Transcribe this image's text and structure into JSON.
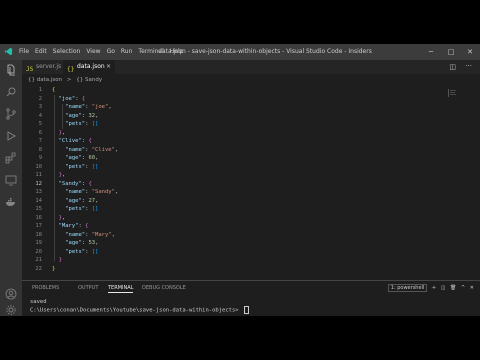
{
  "titlebar": {
    "menus": [
      "File",
      "Edit",
      "Selection",
      "View",
      "Go",
      "Run",
      "Terminal",
      "Help"
    ],
    "window_title": "data.json - save-json-data-within-objects - Visual Studio Code - Insiders"
  },
  "tabs": [
    {
      "icon": "JS",
      "label": "server.js",
      "active": false
    },
    {
      "icon": "{}",
      "label": "data.json",
      "active": true,
      "close": "×"
    }
  ],
  "breadcrumb": [
    "{} data.json",
    ">",
    "{} Sandy"
  ],
  "editor": {
    "line_numbers": [
      "1",
      "2",
      "3",
      "4",
      "5",
      "6",
      "7",
      "8",
      "9",
      "10",
      "11",
      "12",
      "13",
      "14",
      "15",
      "16",
      "17",
      "18",
      "19",
      "20",
      "21",
      "22"
    ],
    "current_line": 12
  },
  "code": {
    "joe_key": "\"joe\"",
    "name_key": "\"name\"",
    "age_key": "\"age\"",
    "pets_key": "\"pets\"",
    "joe_name": "\"joe\"",
    "joe_age": "32",
    "clive_key": "\"Clive\"",
    "clive_name": "\"Clive\"",
    "clive_age": "60",
    "sandy_key": "\"Sandy\"",
    "sandy_name": "\"Sandy\"",
    "sandy_age": "27",
    "mary_key": "\"Mary\"",
    "mary_name": "\"Mary\"",
    "mary_age": "53",
    "empty_array": "[]"
  },
  "panel": {
    "tabs": [
      "PROBLEMS",
      "OUTPUT",
      "TERMINAL",
      "DEBUG CONSOLE"
    ],
    "active_tab": "TERMINAL",
    "shell": "1: powershell",
    "terminal_lines": [
      "saved",
      "C:\\Users\\conan\\Documents\\Youtube\\save-json-data-within-objects> "
    ]
  },
  "colors": {
    "editor_bg": "#1e1e1e",
    "titlebar_bg": "#3c3c3c",
    "activity_bg": "#333333",
    "key": "#9cdcfe",
    "string": "#ce9178",
    "number": "#b5cea8"
  }
}
